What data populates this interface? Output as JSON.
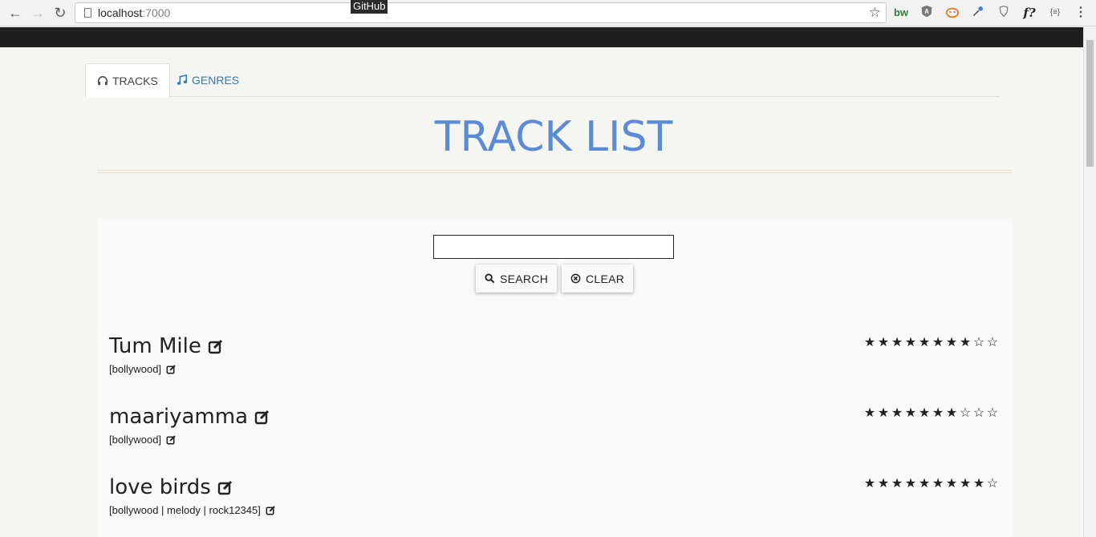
{
  "browser": {
    "url_host": "localhost",
    "url_port": ":7000",
    "tooltip": "GitHub",
    "extensions": [
      "bw",
      "A",
      "f?",
      "{≡}"
    ]
  },
  "tabs": [
    {
      "label": "TRACKS",
      "icon": "headphones-icon",
      "active": true
    },
    {
      "label": "GENRES",
      "icon": "music-note-icon",
      "active": false
    }
  ],
  "page_title": "TRACK LIST",
  "search": {
    "value": "",
    "search_label": "SEARCH",
    "clear_label": "CLEAR"
  },
  "tracks": [
    {
      "name": "Tum Mile",
      "genres": "[bollywood]",
      "rating": 8,
      "max_rating": 10
    },
    {
      "name": "maariyamma",
      "genres": "[bollywood]",
      "rating": 7,
      "max_rating": 10
    },
    {
      "name": "love birds",
      "genres": "[bollywood | melody | rock12345]",
      "rating": 9,
      "max_rating": 10
    }
  ],
  "colors": {
    "title": "#5b8bd6",
    "link": "#337ab7",
    "top_bar": "#1f1f1f"
  }
}
